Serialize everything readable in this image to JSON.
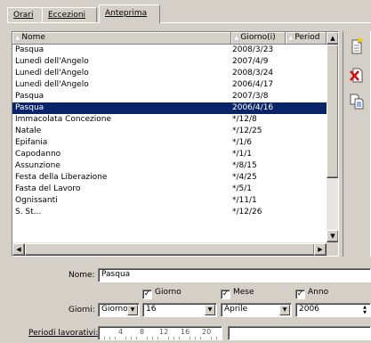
{
  "tabs": [
    {
      "label": "Orari",
      "active": false
    },
    {
      "label": "Eccezioni",
      "active": false
    },
    {
      "label": "Anteprima",
      "active": true
    }
  ],
  "grid": {
    "columns": [
      "Nome",
      "Giorno(i)",
      "Period"
    ],
    "rows": [
      {
        "name": "Pasqua",
        "day": "2008/3/23"
      },
      {
        "name": "Lunedì dell'Angelo",
        "day": "2007/4/9"
      },
      {
        "name": "Lunedì dell'Angelo",
        "day": "2008/3/24"
      },
      {
        "name": "Lunedì dell'Angelo",
        "day": "2006/4/17"
      },
      {
        "name": "Pasqua",
        "day": "2007/3/8"
      },
      {
        "name": "Pasqua",
        "day": "2006/4/16",
        "selected": true
      },
      {
        "name": "Immacolata Concezione",
        "day": "*/12/8"
      },
      {
        "name": "Natale",
        "day": "*/12/25"
      },
      {
        "name": "Epifania",
        "day": "*/1/6"
      },
      {
        "name": "Capodanno",
        "day": "*/1/1"
      },
      {
        "name": "Assunzione",
        "day": "*/8/15"
      },
      {
        "name": "Festa della Liberazione",
        "day": "*/4/25"
      },
      {
        "name": "Fasta del Lavoro",
        "day": "*/5/1"
      },
      {
        "name": "Ognissanti",
        "day": "*/11/1"
      },
      {
        "name": "S. St...",
        "day": "*/12/26"
      }
    ]
  },
  "toolbar": {
    "new_icon": "new-document-icon",
    "delete_icon": "delete-icon",
    "duplicate_icon": "duplicate-icon"
  },
  "form": {
    "name_label": "Nome:",
    "name_value": "Pasqua",
    "check_giorno": "Giorno",
    "check_mese": "Mese",
    "check_anno": "Anno",
    "days_label": "Giorni:",
    "days_type": "Giorno",
    "day_value": "16",
    "month_value": "Aprile",
    "year_value": "2006",
    "workdays_label": "Periodi lavorativi:",
    "ruler_marks": [
      "4",
      "8",
      "12",
      "16",
      "20"
    ]
  },
  "colors": {
    "selection": "#0a246a",
    "face": "#d4d0c8"
  }
}
